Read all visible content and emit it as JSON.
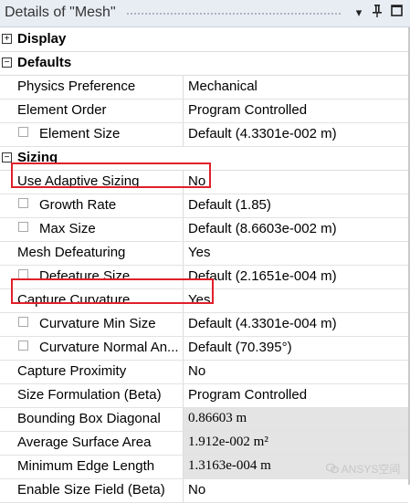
{
  "panel": {
    "title": "Details of \"Mesh\""
  },
  "toolbar": {
    "dropdown_glyph": "▾",
    "pin_glyph": "⊥",
    "restore_glyph": "□"
  },
  "categories": {
    "display": {
      "name": "Display",
      "toggle": "+"
    },
    "defaults": {
      "name": "Defaults",
      "toggle": "−"
    },
    "sizing": {
      "name": "Sizing",
      "toggle": "−"
    }
  },
  "rows": [
    {
      "label": "Physics Preference",
      "value": "Mechanical"
    },
    {
      "label": "Element Order",
      "value": "Program Controlled"
    },
    {
      "label": "Element Size",
      "value": "Default (4.3301e-002 m)"
    },
    {
      "label": "Use Adaptive Sizing",
      "value": "No"
    },
    {
      "label": "Growth Rate",
      "value": "Default (1.85)"
    },
    {
      "label": "Max Size",
      "value": "Default (8.6603e-002 m)"
    },
    {
      "label": "Mesh Defeaturing",
      "value": "Yes"
    },
    {
      "label": "Defeature Size",
      "value": "Default (2.1651e-004 m)"
    },
    {
      "label": "Capture Curvature",
      "value": "Yes"
    },
    {
      "label": "Curvature Min Size",
      "value": "Default (4.3301e-004 m)"
    },
    {
      "label": "Curvature Normal An...",
      "value": "Default (70.395°)"
    },
    {
      "label": "Capture Proximity",
      "value": "No"
    },
    {
      "label": "Size Formulation (Beta)",
      "value": "Program Controlled"
    },
    {
      "label": "Bounding Box Diagonal",
      "value": "0.86603 m"
    },
    {
      "label": "Average Surface Area",
      "value": "1.912e-002 m²"
    },
    {
      "label": "Minimum Edge Length",
      "value": "1.3163e-004 m"
    },
    {
      "label": "Enable Size Field (Beta)",
      "value": "No"
    }
  ],
  "watermark": "ANSYS空间",
  "colors": {
    "highlight": "#e0202a",
    "readonly_bg": "#e4e4e4",
    "titlebar_bg": "#e8edf4"
  }
}
